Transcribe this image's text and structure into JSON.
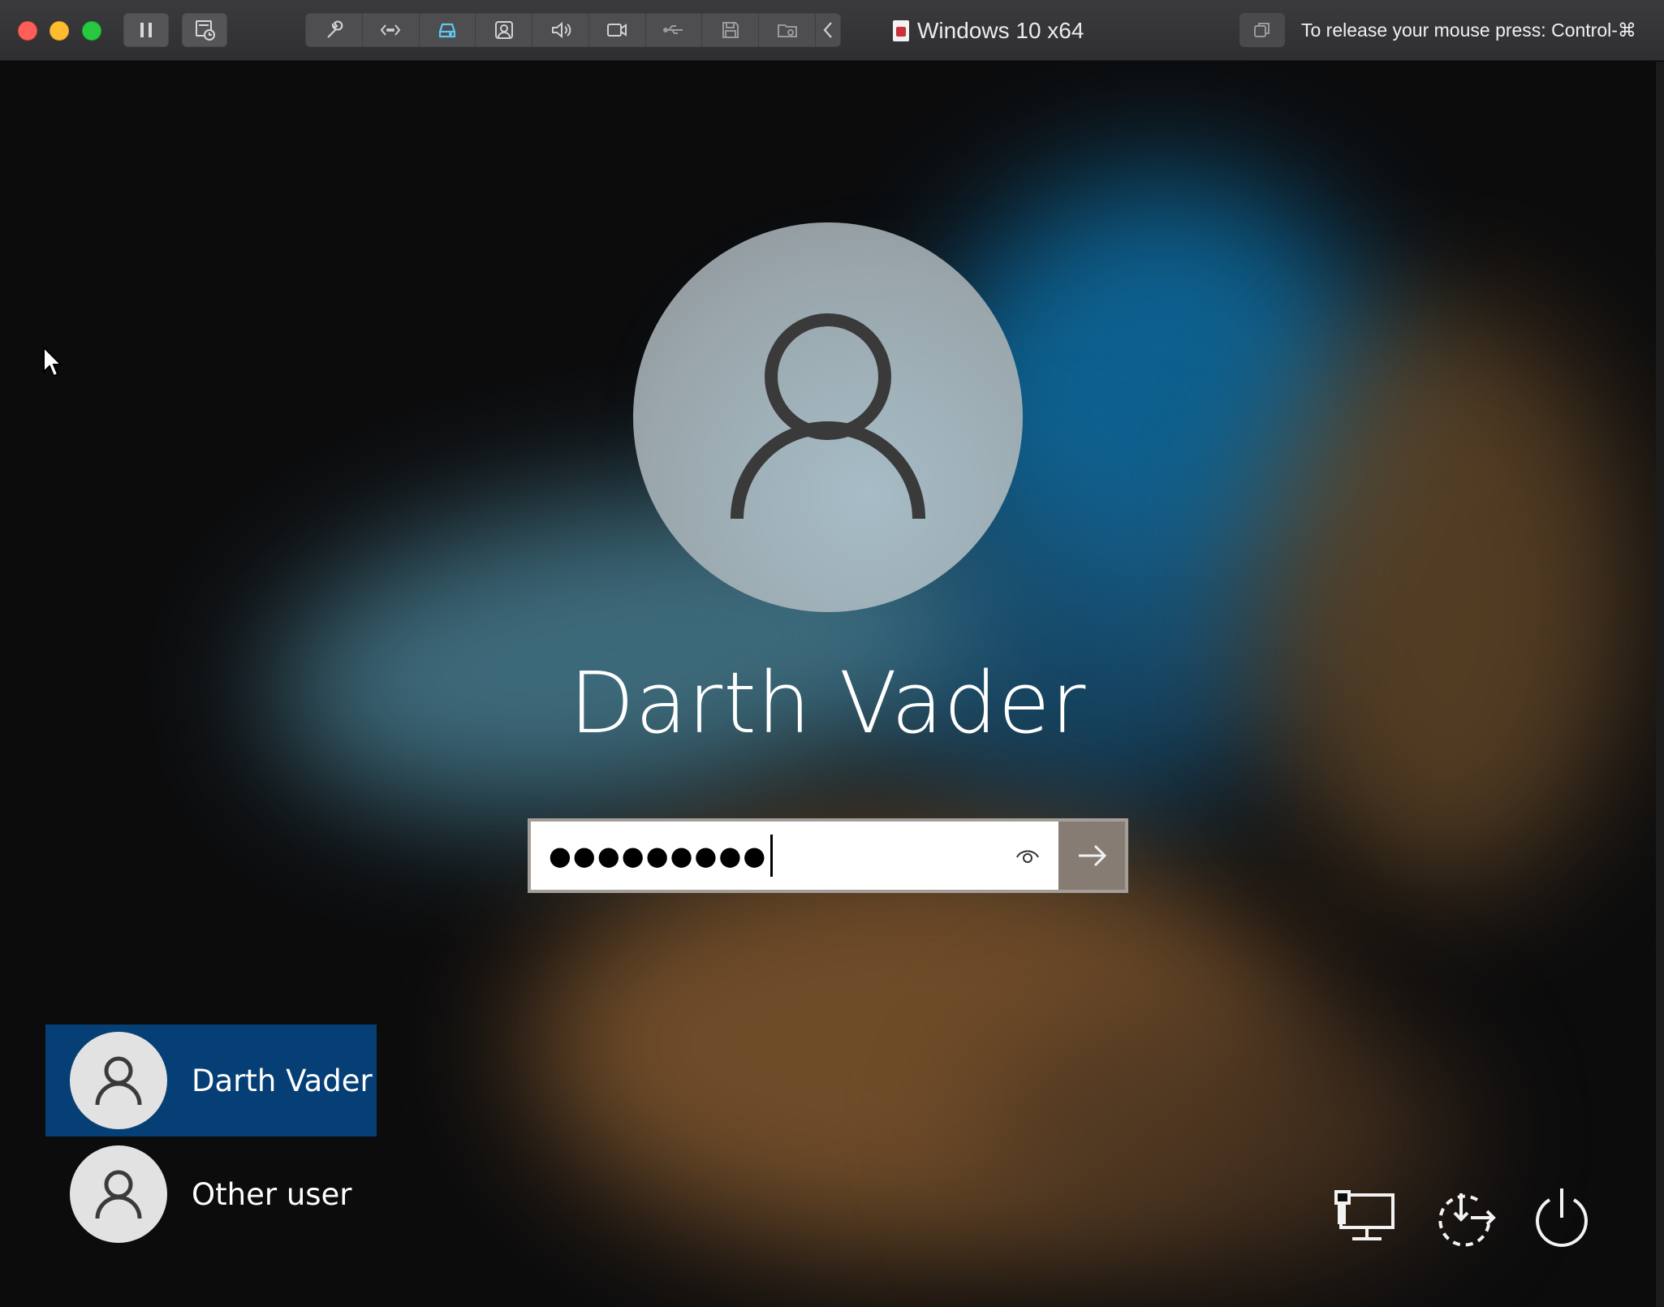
{
  "host": {
    "window_title": "Windows 10 x64",
    "release_hint": "To release your mouse press: Control-⌘",
    "toolbar_icons": [
      "wrench-icon",
      "network-icon",
      "harddisk-icon",
      "camera-share-icon",
      "speaker-icon",
      "video-icon",
      "usb-icon",
      "floppy-icon",
      "shared-folder-icon",
      "chevron-left-icon"
    ]
  },
  "login": {
    "user_name": "Darth Vader",
    "password_masked": "●●●●●●●●●"
  },
  "user_list": [
    {
      "label": "Darth Vader",
      "selected": true
    },
    {
      "label": "Other user",
      "selected": false
    }
  ],
  "system_buttons": [
    "network-icon",
    "ease-of-access-icon",
    "power-icon"
  ],
  "colors": {
    "selected_tile": "#053f75",
    "submit_button": "#877c73",
    "close": "#ff5f57",
    "minimize": "#febc2e",
    "maximize": "#28c840"
  }
}
